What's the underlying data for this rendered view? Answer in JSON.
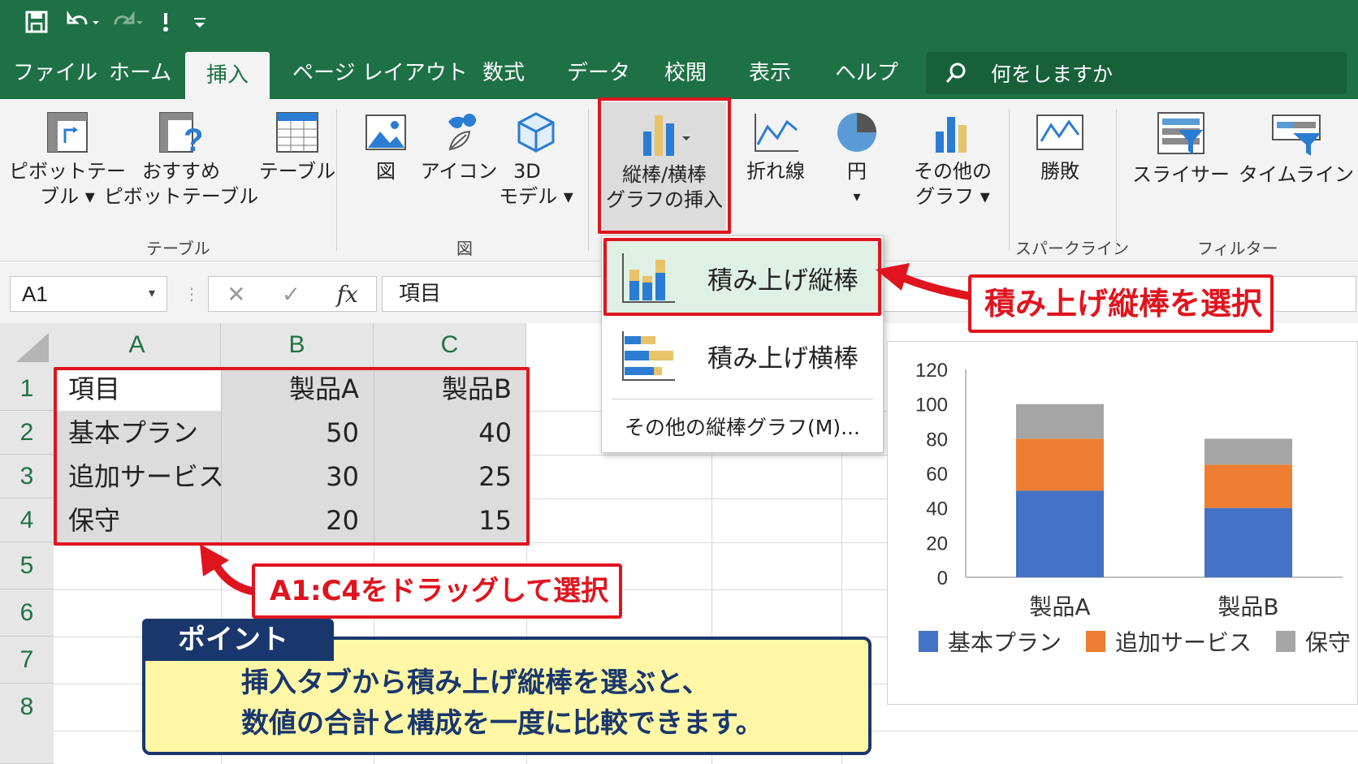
{
  "tabs": [
    "ファイル",
    "ホーム",
    "挿入",
    "ページ レイアウト",
    "数式",
    "データ",
    "校閲",
    "表示",
    "ヘルプ"
  ],
  "active_tab": "挿入",
  "search": {
    "placeholder": "何をしますか"
  },
  "ribbon": {
    "pivot_line1": "ピボットテー",
    "pivot_line2": "ブル",
    "recpivot_line1": "おすすめ",
    "recpivot_line2": "ピボットテーブル",
    "table": "テーブル",
    "picture": "図",
    "icons": "アイコン",
    "model3d_line1": "3D",
    "model3d_line2": "モデル",
    "column_line1": "縦棒/横棒",
    "column_line2": "グラフの挿入",
    "line": "折れ線",
    "pie": "円",
    "other_line1": "その他の",
    "other_line2": "グラフ",
    "winloss": "勝敗",
    "slicer": "スライサー",
    "timeline": "タイムライン",
    "group_table": "テーブル",
    "group_figure": "図",
    "group_spark": "スパークライン",
    "group_filter": "フィルター"
  },
  "formula": {
    "cell_ref": "A1",
    "value": "項目",
    "fx": "fx"
  },
  "columns": [
    "A",
    "B",
    "C"
  ],
  "rows": [
    "1",
    "2",
    "3",
    "4",
    "5",
    "6",
    "7",
    "8"
  ],
  "table": {
    "header": [
      "項目",
      "製品A",
      "製品B"
    ],
    "rows": [
      [
        "基本プラン",
        "50",
        "40"
      ],
      [
        "追加サービス",
        "30",
        "25"
      ],
      [
        "保守",
        "20",
        "15"
      ]
    ]
  },
  "dropdown": {
    "stacked_column": "積み上げ縦棒",
    "stacked_bar": "積み上げ横棒",
    "more": "その他の縦棒グラフ(M)..."
  },
  "callouts": {
    "select_stacked": "積み上げ縦棒を選択",
    "drag_select": "A1:C4をドラッグして選択"
  },
  "point": {
    "label": "ポイント",
    "line1": "挿入タブから積み上げ縦棒を選ぶと、",
    "line2": "数値の合計と構成を一度に比較できます。"
  },
  "colors": {
    "excel_green": "#1e7145",
    "red": "#e0141e",
    "navy": "#19376d",
    "blue": "#4472c4",
    "orange": "#ed7d31",
    "gray": "#a5a5a5"
  },
  "chart_data": {
    "type": "bar",
    "stacked": true,
    "categories": [
      "製品A",
      "製品B"
    ],
    "series": [
      {
        "name": "基本プラン",
        "values": [
          50,
          40
        ],
        "color": "#4472c4"
      },
      {
        "name": "追加サービス",
        "values": [
          30,
          25
        ],
        "color": "#ed7d31"
      },
      {
        "name": "保守",
        "values": [
          20,
          15
        ],
        "color": "#a5a5a5"
      }
    ],
    "ylim": [
      0,
      120
    ],
    "yticks": [
      0,
      20,
      40,
      60,
      80,
      100,
      120
    ],
    "legend": "bottom",
    "grid": false
  }
}
